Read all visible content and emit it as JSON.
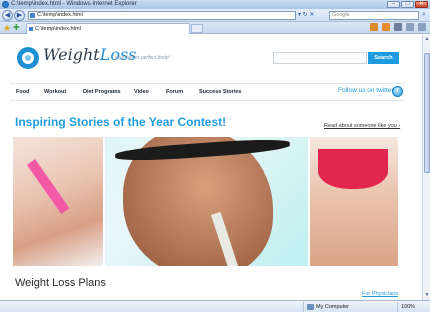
{
  "window": {
    "title": "C:\\temp\\index.html - Windows Internet Explorer",
    "buttons": {
      "minimize": "–",
      "maximize": "□",
      "close": "✕"
    }
  },
  "toolbar": {
    "address": "C:\\temp\\index.html",
    "search_placeholder": "Google",
    "search_icon": "magnifier-icon",
    "go_glyphs": "▾ ↻ ✕"
  },
  "tabs": [
    {
      "label": "C:\\temp\\index.html"
    }
  ],
  "site": {
    "logo": {
      "weight": "Weight",
      "loss": "Loss"
    },
    "tagline": "your key to perfect body!",
    "search_button": "Search",
    "nav": [
      {
        "label": "Food"
      },
      {
        "label": "Workout"
      },
      {
        "label": "Diet Programs"
      },
      {
        "label": "Video"
      },
      {
        "label": "Forum"
      },
      {
        "label": "Success Stories"
      }
    ],
    "follow": "Follow us on twitter!",
    "twitter_glyph": "t",
    "contest_title": "Inspiring Stories of the Year Contest!",
    "read_link": "Read about someone like you  ›",
    "section_title": "Weight Loss Plans",
    "physicians_link": "For Physicians"
  },
  "statusbar": {
    "zone": "My Computer",
    "zoom": "100%"
  },
  "colors": {
    "accent": "#1f9ce0",
    "close_button": "#c9452a"
  }
}
